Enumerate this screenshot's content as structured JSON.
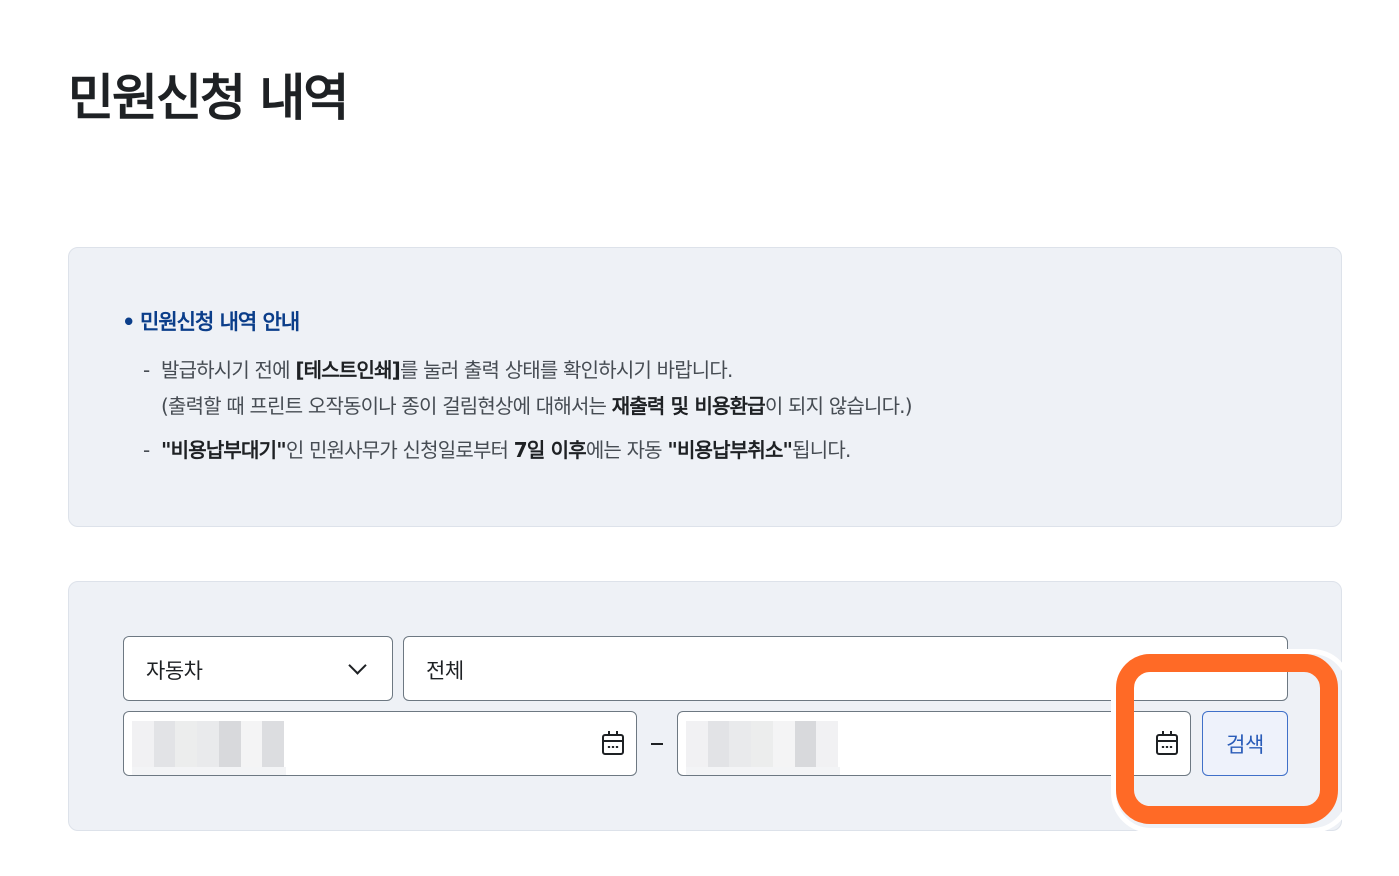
{
  "page": {
    "title": "민원신청 내역"
  },
  "notice": {
    "heading": "민원신청 내역 안내",
    "bullet": "•",
    "items": [
      {
        "line1": {
          "pre": "발급하시기 전에 ",
          "bold1": "[테스트인쇄]",
          "post": "를 눌러 출력 상태를 확인하시기 바랍니다."
        },
        "line2": {
          "pre": "(출력할 때 프린트 오작동이나 종이 걸림현상에 대해서는 ",
          "bold1": "재출력 및 비용환급",
          "post": "이 되지 않습니다.)"
        }
      },
      {
        "line1": {
          "bold1": "\"비용납부대기\"",
          "mid1": "인 민원사무가 신청일로부터 ",
          "bold2": "7일 이후",
          "mid2": "에는 자동 ",
          "bold3": "\"비용납부취소\"",
          "post": "됩니다."
        }
      }
    ],
    "dash": "-"
  },
  "search": {
    "category_value": "자동차",
    "type_value": "전체",
    "date_start_value": "",
    "date_end_value": "",
    "range_separator": "–",
    "button_label": "검색"
  },
  "icons": {
    "category_dropdown": "chevron-down-icon",
    "date_picker": "calendar-icon"
  },
  "colors": {
    "highlight": "#ff6a26",
    "notice_heading": "#0b3e8a",
    "button_border": "#3f70c9",
    "panel_bg": "#eef1f6"
  }
}
